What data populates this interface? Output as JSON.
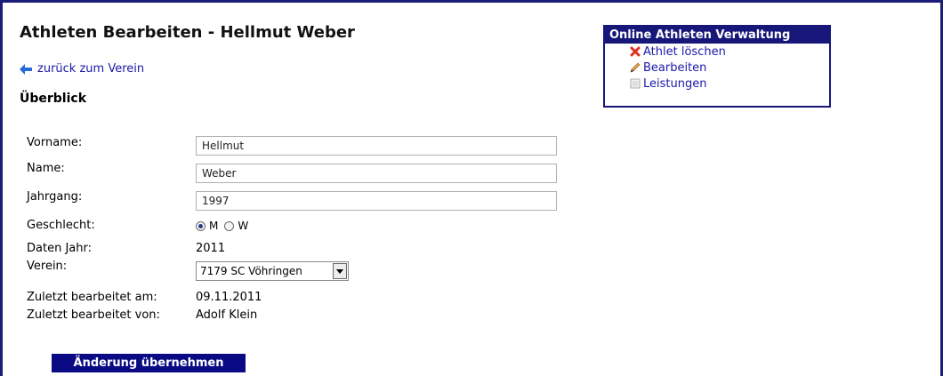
{
  "title": "Athleten Bearbeiten - Hellmut Weber",
  "back_link": "zurück zum Verein",
  "section": "Überblick",
  "form": {
    "vorname_label": "Vorname:",
    "vorname_value": "Hellmut",
    "name_label": "Name:",
    "name_value": "Weber",
    "jahrgang_label": "Jahrgang:",
    "jahrgang_value": "1997",
    "geschlecht_label": "Geschlecht:",
    "geschlecht_m": "M",
    "geschlecht_w": "W",
    "geschlecht_selected": "M",
    "daten_jahr_label": "Daten Jahr:",
    "daten_jahr_value": "2011",
    "verein_label": "Verein:",
    "verein_value": "7179 SC Vöhringen",
    "zuletzt_am_label": "Zuletzt bearbeitet am:",
    "zuletzt_am_value": "09.11.2011",
    "zuletzt_von_label": "Zuletzt bearbeitet von:",
    "zuletzt_von_value": "Adolf Klein"
  },
  "submit_label": "Änderung übernehmen",
  "side_panel": {
    "header": "Online Athleten Verwaltung",
    "items": [
      {
        "label": "Athlet löschen",
        "icon": "delete-icon"
      },
      {
        "label": "Bearbeiten",
        "icon": "pencil-icon"
      },
      {
        "label": "Leistungen",
        "icon": "document-icon"
      }
    ]
  },
  "colors": {
    "frame": "#1c1c7a",
    "link": "#1a1aa8",
    "button_bg": "#0a0a85",
    "panel_header": "#17177a"
  }
}
